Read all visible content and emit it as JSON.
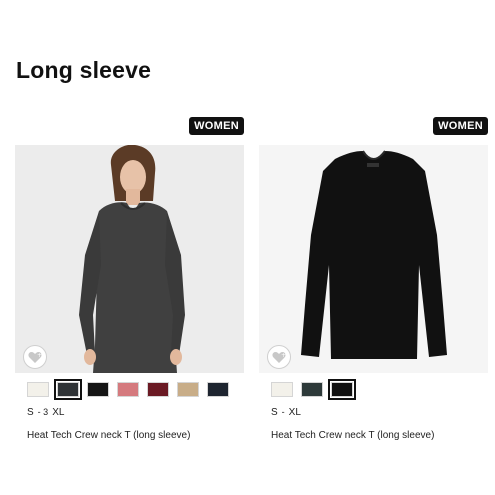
{
  "section": {
    "title": "Long sleeve"
  },
  "products": [
    {
      "badge": "WOMEN",
      "name": "Heat Tech Crew neck T (long sleeve)",
      "sizes": {
        "from": "S",
        "separator": "- 3",
        "to": "XL"
      },
      "colors": [
        "#f3f1ea",
        "#2f3336",
        "#151515",
        "#d57a7e",
        "#6b1a24",
        "#c8ad88",
        "#1e2530"
      ],
      "selected_color_index": 1,
      "image": "woman-gray-long-sleeve-photo"
    },
    {
      "badge": "WOMEN",
      "name": "Heat Tech Crew neck T (long sleeve)",
      "sizes": {
        "from": "S",
        "separator": "-",
        "to": "XL"
      },
      "colors": [
        "#f3f1ea",
        "#2e3a3a",
        "#111111"
      ],
      "selected_color_index": 2,
      "image": "black-long-sleeve-flat-photo"
    }
  ]
}
